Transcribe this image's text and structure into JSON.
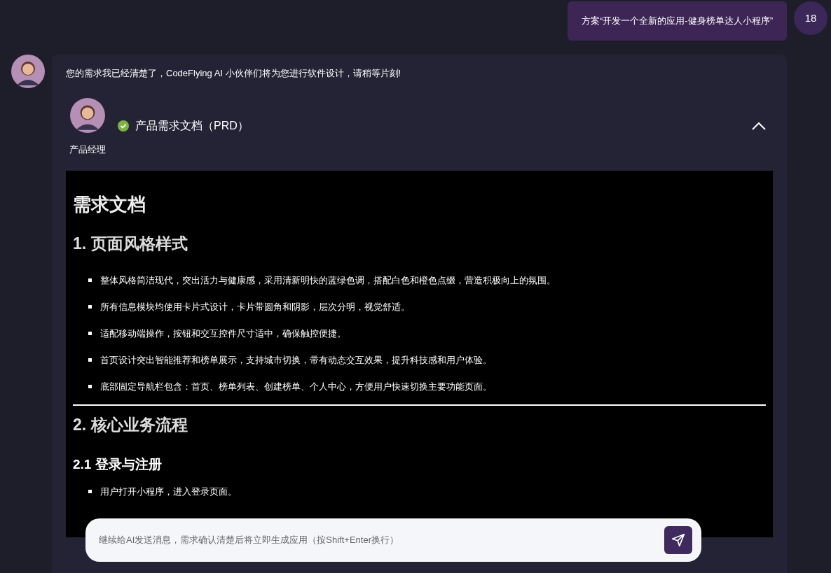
{
  "user_message": {
    "text": "方案“开发一个全新的应用-健身榜单达人小程序”",
    "avatar_text": "18"
  },
  "assistant_message": {
    "text": "您的需求我已经清楚了，CodeFlying AI 小伙伴们将为您进行软件设计，请稍等片刻!",
    "task": {
      "role": "产品经理",
      "title": "产品需求文档（PRD）",
      "done": true,
      "expanded": true
    },
    "document": [
      {
        "kind": "h1",
        "text": "需求文档"
      },
      {
        "kind": "h2",
        "text": "1. 页面风格样式"
      },
      {
        "kind": "ul",
        "items": [
          {
            "text": "整体风格简洁现代，突出活力与健康感，采用清新明快的蓝绿色调，搭配白色和橙色点缀，营造积极向上的氛围。"
          },
          {
            "text": "所有信息模块均使用卡片式设计，卡片带圆角和阴影，层次分明，视觉舒适。"
          },
          {
            "text": "适配移动端操作，按钮和交互控件尺寸适中，确保触控便捷。"
          },
          {
            "text": "首页设计突出智能推荐和榜单展示，支持城市切换，带有动态交互效果，提升科技感和用户体验。"
          },
          {
            "text": "底部固定导航栏包含：首页、榜单列表、创建榜单、个人中心，方便用户快速切换主要功能页面。"
          }
        ]
      },
      {
        "kind": "hr"
      },
      {
        "kind": "h2",
        "text": "2. 核心业务流程"
      },
      {
        "kind": "h3",
        "text": "2.1 登录与注册"
      },
      {
        "kind": "ul",
        "items": [
          {
            "text": "用户打开小程序，进入登录页面。"
          }
        ]
      }
    ]
  },
  "composer": {
    "placeholder": "继续给AI发送消息，需求确认清楚后将立即生成应用（按Shift+Enter换行）"
  }
}
